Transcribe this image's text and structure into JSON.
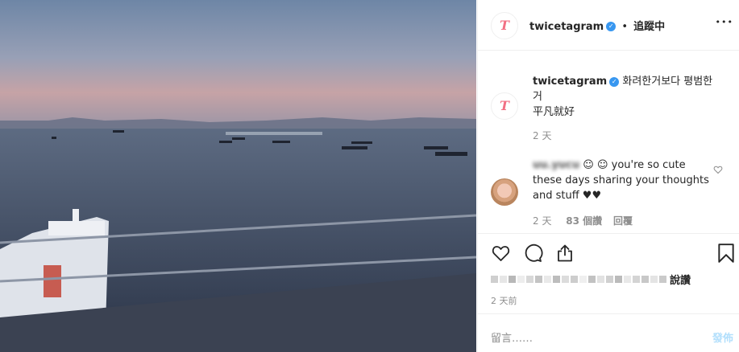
{
  "post": {
    "author": {
      "username": "twicetagram",
      "follow_status": "追蹤中",
      "dot_separator": "•",
      "avatar_text": "T"
    },
    "caption": {
      "text_line1": "화려한거보다 평범한",
      "text_line2": "거",
      "text_line3": "平凡就好",
      "age": "2 天"
    },
    "comments": [
      {
        "username_blurred": "uu.yucu",
        "text_line1": "☺ ☺ you're so cute",
        "text_line2": "these days sharing your thoughts",
        "text_line3": "and stuff ♥♥",
        "age": "2 天",
        "likes": "83 個讚",
        "reply_label": "回覆"
      }
    ],
    "likes_suffix": "說讚",
    "timestamp": "2 天前",
    "comment_placeholder": "留言……",
    "post_button": "發佈",
    "more_icon_glyph": "•••"
  },
  "colors": {
    "accent_blue": "#3897f0",
    "post_button_disabled": "#b2dffc",
    "logo_pink": "#f26f83"
  },
  "icons": [
    "more-options-icon",
    "verified-badge-icon",
    "heart-icon",
    "comment-icon",
    "share-icon",
    "bookmark-icon",
    "comment-like-icon"
  ]
}
